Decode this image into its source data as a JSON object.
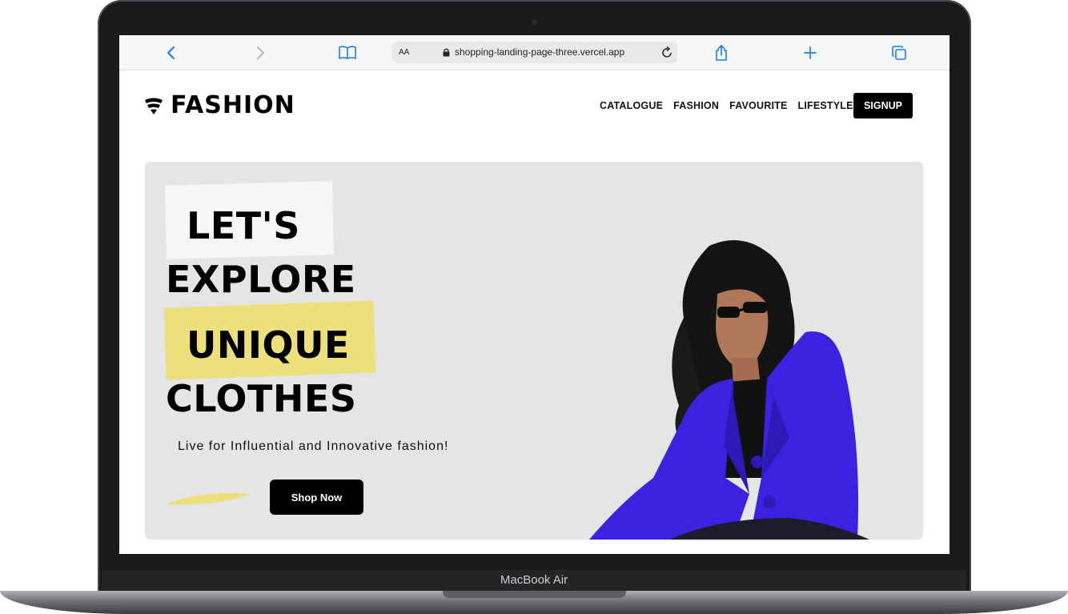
{
  "device": {
    "label": "MacBook Air"
  },
  "browser": {
    "text_size_label": "AA",
    "url": "shopping-landing-page-three.vercel.app"
  },
  "site": {
    "logo_text": "FASHION",
    "nav": [
      "CATALOGUE",
      "FASHION",
      "FAVOURITE",
      "LIFESTYLE"
    ],
    "signup_label": "SIGNUP"
  },
  "hero": {
    "line1": "LET'S",
    "line2": "EXPLORE",
    "line3": "UNIQUE",
    "line4": "CLOTHES",
    "tagline": "Live for Influential and Innovative fashion!",
    "cta_label": "Shop Now"
  },
  "colors": {
    "accent_yellow": "#ece07c",
    "jacket_purple": "#3b22e0",
    "hero_bg": "#e5e5e5",
    "link_blue": "#1a7cf2"
  },
  "icons": [
    "back-arrow-icon",
    "forward-arrow-icon",
    "book-icon",
    "lock-icon",
    "reload-icon",
    "share-icon",
    "new-tab-icon",
    "tabs-icon",
    "wifi-logo-icon"
  ]
}
